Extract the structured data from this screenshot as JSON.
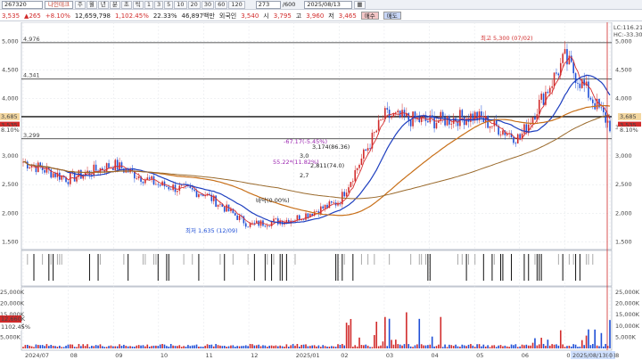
{
  "toolbar": {
    "code": "267320",
    "name": "나인테크",
    "period_buttons": [
      "주",
      "월",
      "년",
      "분",
      "초",
      "틱",
      "1",
      "3",
      "5",
      "10",
      "20",
      "30",
      "60",
      "120"
    ],
    "zoom": "273",
    "zoom_total": "/600",
    "date": "2025/08/13"
  },
  "info": {
    "price": "3,535",
    "change": "265",
    "change_pct": "+8.10%",
    "volume": "12,659,798",
    "vol_ratio": "1,102.45%",
    "turnover": "22.33%",
    "amount": "46,897백만",
    "foreign_label": "외국인",
    "foreign_val": "3,540",
    "open_label": "시",
    "open": "3,795",
    "high_label": "고",
    "high": "3,960",
    "low_label": "저",
    "low": "3,465",
    "buy_label": "매수",
    "sell_label": "매도"
  },
  "price_panel": {
    "y_ticks": [
      "5,000",
      "4,500",
      "4,000",
      "3,500",
      "3,000",
      "2,500",
      "2,000",
      "1,500"
    ],
    "levels": [
      "4,976",
      "4,341",
      "3,299"
    ],
    "current_tags": [
      "3,685",
      "3,535",
      "8.10%"
    ],
    "right_top": [
      "LC:116.21",
      "HC:-33.30"
    ],
    "annotations": {
      "high": "최고 5,300 (07/02)",
      "low": "최저 1,635 (12/09)",
      "a1": "-67.17(-5.45%)",
      "a2": "55.22*(11.82%)",
      "a3": "3,174(86.36)",
      "a4": "2,811(74.0)",
      "a5": "2,7",
      "a6": "3,0",
      "a7": "바닥(0.00%)"
    }
  },
  "volume_panel": {
    "y_ticks": [
      "25,000K",
      "20,000K",
      "15,000K",
      "10,000K",
      "5,000K"
    ],
    "tags": [
      "12,660K",
      "1102.45%"
    ]
  },
  "x_axis": {
    "labels": [
      "2024/07",
      "08",
      "09",
      "10",
      "11",
      "12",
      "2025/01",
      "02",
      "03",
      "04",
      "05",
      "06",
      "07",
      "08"
    ],
    "end_label": "2025/08/13(수)"
  },
  "colors": {
    "up": "#d12b2b",
    "down": "#1f4fd6",
    "ma5": "#d63031",
    "ma20": "#1e3fbf",
    "ma60": "#c8701a",
    "ma120": "#9a6a2c"
  },
  "chart_data": {
    "type": "line",
    "title": "",
    "x": [
      "2024/07",
      "08",
      "09",
      "10",
      "11",
      "12",
      "2025/01",
      "02",
      "03",
      "04",
      "05",
      "06",
      "07",
      "08"
    ],
    "series": [
      {
        "values": [
          2900,
          2600,
          2850,
          2500,
          2350,
          1800,
          1900,
          2200,
          3700,
          3600,
          3700,
          3300,
          4700,
          3535
        ]
      }
    ],
    "ylim": [
      1400,
      5300
    ],
    "levels": [
      4976,
      4341,
      3299
    ]
  }
}
